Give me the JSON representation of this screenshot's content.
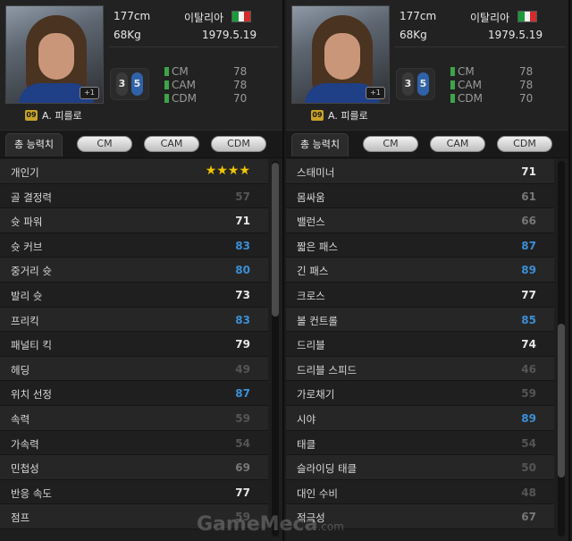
{
  "players": [
    {
      "name": "A. 피를로",
      "number": "09",
      "height": "177cm",
      "weight": "68Kg",
      "nation": "이탈리아",
      "birth": "1979.5.19",
      "level": "+1",
      "foot_left": "3",
      "foot_right": "5",
      "positions": [
        {
          "label": "CM",
          "value": "78"
        },
        {
          "label": "CAM",
          "value": "78"
        },
        {
          "label": "CDM",
          "value": "70"
        }
      ],
      "tabs": {
        "active": "총 능력치",
        "buttons": [
          "CM",
          "CAM",
          "CDM"
        ]
      },
      "stats": [
        {
          "label": "개인기",
          "value": "",
          "stars": "★★★★"
        },
        {
          "label": "골 결정력",
          "value": "57",
          "color": "#555555"
        },
        {
          "label": "슛 파워",
          "value": "71",
          "color": "#e8e8e8"
        },
        {
          "label": "슛 커브",
          "value": "83",
          "color": "#3b8fd6"
        },
        {
          "label": "중거리 슛",
          "value": "80",
          "color": "#3b8fd6"
        },
        {
          "label": "발리 슛",
          "value": "73",
          "color": "#e8e8e8"
        },
        {
          "label": "프리킥",
          "value": "83",
          "color": "#3b8fd6"
        },
        {
          "label": "패널티 킥",
          "value": "79",
          "color": "#e8e8e8"
        },
        {
          "label": "헤딩",
          "value": "49",
          "color": "#555555"
        },
        {
          "label": "위치 선정",
          "value": "87",
          "color": "#3b8fd6"
        },
        {
          "label": "속력",
          "value": "59",
          "color": "#555555"
        },
        {
          "label": "가속력",
          "value": "54",
          "color": "#555555"
        },
        {
          "label": "민첩성",
          "value": "69",
          "color": "#777777"
        },
        {
          "label": "반응 속도",
          "value": "77",
          "color": "#e8e8e8"
        },
        {
          "label": "점프",
          "value": "59",
          "color": "#555555"
        }
      ]
    },
    {
      "name": "A. 피를로",
      "number": "09",
      "height": "177cm",
      "weight": "68Kg",
      "nation": "이탈리아",
      "birth": "1979.5.19",
      "level": "+1",
      "foot_left": "3",
      "foot_right": "5",
      "positions": [
        {
          "label": "CM",
          "value": "78"
        },
        {
          "label": "CAM",
          "value": "78"
        },
        {
          "label": "CDM",
          "value": "70"
        }
      ],
      "tabs": {
        "active": "총 능력치",
        "buttons": [
          "CM",
          "CAM",
          "CDM"
        ]
      },
      "stats": [
        {
          "label": "스태미너",
          "value": "71",
          "color": "#e8e8e8"
        },
        {
          "label": "몸싸움",
          "value": "61",
          "color": "#777777"
        },
        {
          "label": "밸런스",
          "value": "66",
          "color": "#777777"
        },
        {
          "label": "짧은 패스",
          "value": "87",
          "color": "#3b8fd6"
        },
        {
          "label": "긴 패스",
          "value": "89",
          "color": "#3b8fd6"
        },
        {
          "label": "크로스",
          "value": "77",
          "color": "#e8e8e8"
        },
        {
          "label": "볼 컨트롤",
          "value": "85",
          "color": "#3b8fd6"
        },
        {
          "label": "드리블",
          "value": "74",
          "color": "#e8e8e8"
        },
        {
          "label": "드리블 스피드",
          "value": "46",
          "color": "#555555"
        },
        {
          "label": "가로채기",
          "value": "59",
          "color": "#555555"
        },
        {
          "label": "시야",
          "value": "89",
          "color": "#3b8fd6"
        },
        {
          "label": "태클",
          "value": "54",
          "color": "#555555"
        },
        {
          "label": "슬라이딩 태클",
          "value": "50",
          "color": "#555555"
        },
        {
          "label": "대인 수비",
          "value": "48",
          "color": "#555555"
        },
        {
          "label": "적극성",
          "value": "67",
          "color": "#777777"
        }
      ]
    }
  ],
  "watermark": "GameMeca",
  "watermark_suffix": ".com",
  "colors": {
    "high": "#3b8fd6",
    "mid": "#e8e8e8",
    "low": "#555555",
    "star": "#f0c600",
    "position_dot": "#3da44a"
  }
}
